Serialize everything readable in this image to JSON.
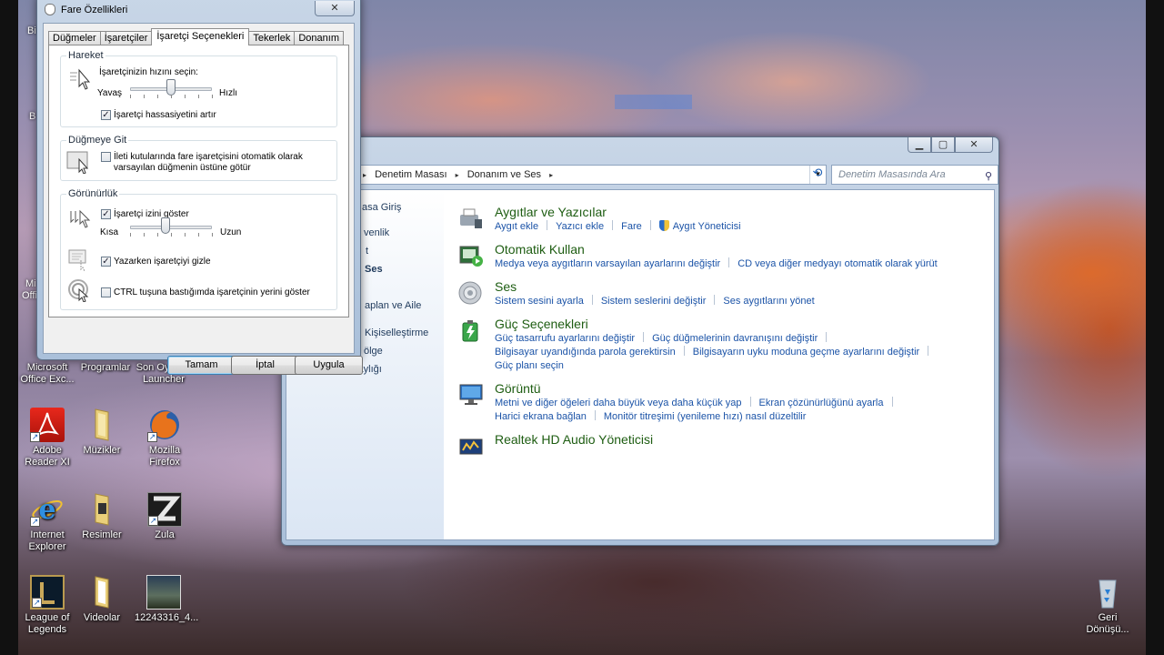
{
  "desktop": {
    "icons": [
      {
        "id": "excel",
        "label1": "Microsoft",
        "label2": "Office Exc..."
      },
      {
        "id": "programs",
        "label1": "Programlar",
        "label2": ""
      },
      {
        "id": "launcher",
        "label1": "Son Oyuncu",
        "label2": "Launcher"
      },
      {
        "id": "adobe",
        "label1": "Adobe",
        "label2": "Reader XI"
      },
      {
        "id": "music",
        "label1": "Müzikler",
        "label2": ""
      },
      {
        "id": "firefox",
        "label1": "Mozilla",
        "label2": "Firefox"
      },
      {
        "id": "ie",
        "label1": "Internet",
        "label2": "Explorer"
      },
      {
        "id": "pictures",
        "label1": "Resimler",
        "label2": ""
      },
      {
        "id": "zula",
        "label1": "Zula",
        "label2": ""
      },
      {
        "id": "lol",
        "label1": "League of",
        "label2": "Legends"
      },
      {
        "id": "videos",
        "label1": "Videolar",
        "label2": ""
      },
      {
        "id": "photo",
        "label1": "12243316_4...",
        "label2": ""
      },
      {
        "id": "recycle",
        "label1": "Geri",
        "label2": "Dönüşü..."
      }
    ],
    "partial_labels": [
      "Bil",
      "B",
      "Mi",
      "Offi"
    ]
  },
  "control_panel": {
    "breadcrumbs": [
      "Denetim Masası",
      "Donanım ve Ses"
    ],
    "search_placeholder": "Denetim Masasında Ara",
    "nav": [
      "asa Giriş",
      "venlik",
      "t",
      "Ses",
      "aplan ve Aile",
      "Kişiselleştirme",
      "ölge",
      "Erişim Kolaylığı"
    ],
    "categories": [
      {
        "title": "Aygıtlar ve Yazıcılar",
        "rows": [
          [
            "Aygıt ekle",
            "Yazıcı ekle",
            "Fare",
            "Aygıt Yöneticisi"
          ]
        ]
      },
      {
        "title": "Otomatik Kullan",
        "rows": [
          [
            "Medya veya aygıtların varsayılan ayarlarını değiştir",
            "CD veya diğer medyayı otomatik olarak yürüt"
          ]
        ]
      },
      {
        "title": "Ses",
        "rows": [
          [
            "Sistem sesini ayarla",
            "Sistem seslerini değiştir",
            "Ses aygıtlarını yönet"
          ]
        ]
      },
      {
        "title": "Güç Seçenekleri",
        "rows": [
          [
            "Güç tasarrufu ayarlarını değiştir",
            "Güç düğmelerinin davranışını değiştir"
          ],
          [
            "Bilgisayar uyandığında parola gerektirsin",
            "Bilgisayarın uyku moduna geçme ayarlarını değiştir"
          ],
          [
            "Güç planı seçin"
          ]
        ]
      },
      {
        "title": "Görüntü",
        "rows": [
          [
            "Metni ve diğer öğeleri daha büyük veya daha küçük yap",
            "Ekran çözünürlüğünü ayarla"
          ],
          [
            "Harici ekrana bağlan",
            "Monitör titreşimi (yenileme hızı) nasıl düzeltilir"
          ]
        ]
      },
      {
        "title": "Realtek HD Audio Yöneticisi",
        "rows": []
      }
    ]
  },
  "mouse_dialog": {
    "title": "Fare Özellikleri",
    "tabs": [
      "Düğmeler",
      "İşaretçiler",
      "İşaretçi Seçenekleri",
      "Tekerlek",
      "Donanım"
    ],
    "active_tab": "İşaretçi Seçenekleri",
    "motion": {
      "legend": "Hareket",
      "prompt": "İşaretçinizin hızını seçin:",
      "slow": "Yavaş",
      "fast": "Hızlı",
      "speed_fraction": 0.5,
      "precision_label": "İşaretçi hassasiyetini artır",
      "precision_checked": true
    },
    "snap": {
      "legend": "Düğmeye Git",
      "line1": "İleti kutularında fare işaretçisini otomatik olarak",
      "line2": "varsayılan düğmenin üstüne götür",
      "checked": false
    },
    "visibility": {
      "legend": "Görünürlük",
      "trails_label": "İşaretçi izini göster",
      "trails_checked": true,
      "short": "Kısa",
      "long": "Uzun",
      "trail_fraction": 0.43,
      "hide_label": "Yazarken işaretçiyi gizle",
      "hide_checked": true,
      "ctrl_label": "CTRL tuşuna bastığımda işaretçinin yerini göster",
      "ctrl_checked": false
    },
    "buttons": {
      "ok": "Tamam",
      "cancel": "İptal",
      "apply": "Uygula"
    }
  },
  "colors": {
    "category_title": "#1e5d12",
    "link": "#1b53a7",
    "nav_text": "#1e395b"
  }
}
